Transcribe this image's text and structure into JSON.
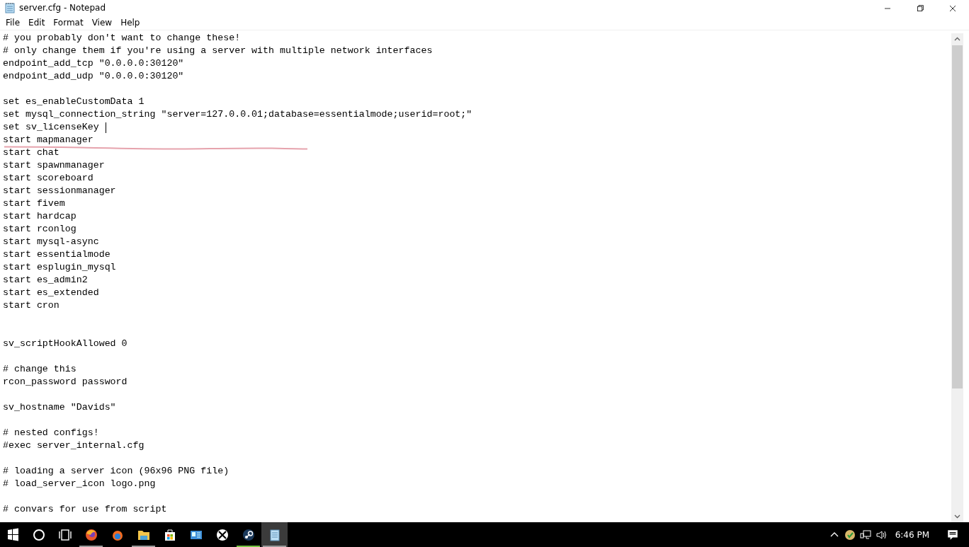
{
  "window": {
    "title": "server.cfg - Notepad"
  },
  "menu": [
    "File",
    "Edit",
    "Format",
    "View",
    "Help"
  ],
  "editor": {
    "lines": [
      {
        "kind": "code",
        "text": "# you probably don't want to change these!"
      },
      {
        "kind": "code",
        "text": "# only change them if you're using a server with multiple network interfaces"
      },
      {
        "kind": "code",
        "text": "endpoint_add_tcp \"0.0.0.0:30120\""
      },
      {
        "kind": "code",
        "text": "endpoint_add_udp \"0.0.0.0:30120\""
      },
      {
        "kind": "blank"
      },
      {
        "kind": "code",
        "text": "set es_enableCustomData 1"
      },
      {
        "kind": "code",
        "text": "set mysql_connection_string \"server=127.0.0.01;database=essentialmode;userid=root;\""
      },
      {
        "kind": "code",
        "text": "set sv_licenseKey",
        "caret": true
      },
      {
        "kind": "code",
        "text": "start mapmanager"
      },
      {
        "kind": "code",
        "text": "start chat"
      },
      {
        "kind": "code",
        "text": "start spawnmanager"
      },
      {
        "kind": "code",
        "text": "start scoreboard"
      },
      {
        "kind": "code",
        "text": "start sessionmanager"
      },
      {
        "kind": "code",
        "text": "start fivem"
      },
      {
        "kind": "code",
        "text": "start hardcap"
      },
      {
        "kind": "code",
        "text": "start rconlog"
      },
      {
        "kind": "code",
        "text": "start mysql-async"
      },
      {
        "kind": "code",
        "text": "start essentialmode"
      },
      {
        "kind": "code",
        "text": "start esplugin_mysql"
      },
      {
        "kind": "code",
        "text": "start es_admin2"
      },
      {
        "kind": "code",
        "text": "start es_extended"
      },
      {
        "kind": "code",
        "text": "start cron"
      },
      {
        "kind": "blank"
      },
      {
        "kind": "blank"
      },
      {
        "kind": "code",
        "text": "sv_scriptHookAllowed 0"
      },
      {
        "kind": "blank"
      },
      {
        "kind": "code",
        "text": "# change this"
      },
      {
        "kind": "code",
        "text": "rcon_password password"
      },
      {
        "kind": "blank"
      },
      {
        "kind": "code",
        "text": "sv_hostname \"Davids\""
      },
      {
        "kind": "blank"
      },
      {
        "kind": "code",
        "text": "# nested configs!"
      },
      {
        "kind": "code",
        "text": "#exec server_internal.cfg"
      },
      {
        "kind": "blank"
      },
      {
        "kind": "code",
        "text": "# loading a server icon (96x96 PNG file)"
      },
      {
        "kind": "code",
        "text": "# load_server_icon logo.png"
      },
      {
        "kind": "blank"
      },
      {
        "kind": "code",
        "text": "# convars for use from script"
      }
    ]
  },
  "taskbar": {
    "apps": [
      {
        "kind": "search",
        "running": false,
        "selected": false
      },
      {
        "kind": "taskview",
        "running": false,
        "selected": false
      },
      {
        "kind": "firefox",
        "running": true,
        "selected": false
      },
      {
        "kind": "firefox-dev",
        "running": false,
        "selected": false
      },
      {
        "kind": "explorer",
        "running": true,
        "selected": false
      },
      {
        "kind": "store",
        "running": false,
        "selected": false
      },
      {
        "kind": "card",
        "running": false,
        "selected": false
      },
      {
        "kind": "xbox",
        "running": false,
        "selected": false
      },
      {
        "kind": "steam",
        "running": true,
        "selected": false
      },
      {
        "kind": "notepad",
        "running": true,
        "selected": true
      }
    ],
    "clock": "6:46 PM"
  }
}
